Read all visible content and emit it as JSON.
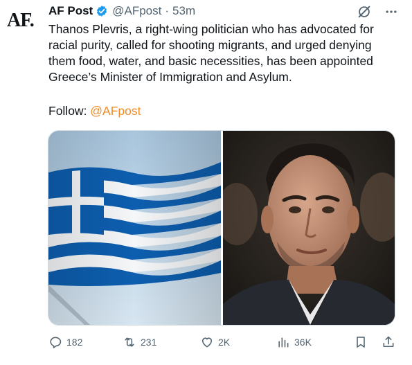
{
  "avatar": {
    "text": "AF."
  },
  "header": {
    "name": "AF Post",
    "handle": "@AFpost",
    "separator": "·",
    "time": "53m"
  },
  "tweet": {
    "text": "Thanos Plevris, a right-wing politician who has advocated for racial purity, called for shooting migrants, and urged denying them food, water, and basic necessities, has been appointed Greece’s Minister of Immigration and Asylum.",
    "follow_label": "Follow: ",
    "follow_mention": "@AFpost"
  },
  "actions": {
    "replies": "182",
    "reposts": "231",
    "likes": "2K",
    "views": "36K"
  },
  "colors": {
    "verified": "#1d9bf0",
    "mention": "#f08a24",
    "secondary": "#536471",
    "flag_blue": "#0d5eaf"
  },
  "icons": [
    "verified-badge-icon",
    "grok-icon",
    "more-icon",
    "reply-icon",
    "repost-icon",
    "like-icon",
    "views-icon",
    "bookmark-icon",
    "share-icon"
  ]
}
